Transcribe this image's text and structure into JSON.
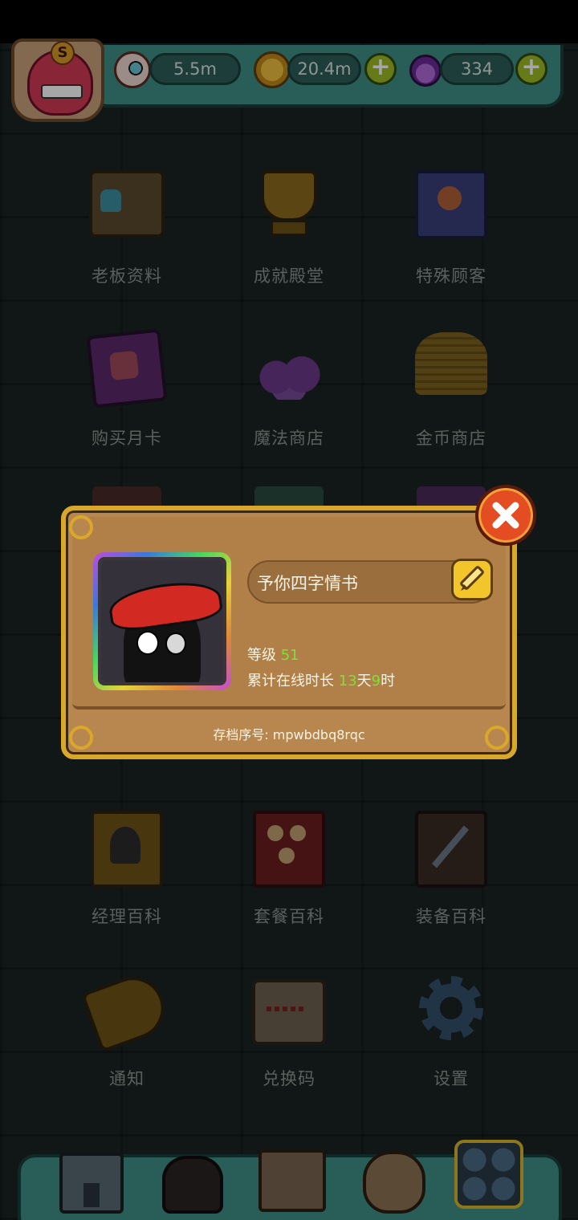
{
  "resources": {
    "eyes": "5.5m",
    "coins": "20.4m",
    "potions": "334"
  },
  "menu": {
    "row1": [
      "老板资料",
      "成就殿堂",
      "特殊顾客"
    ],
    "row2": [
      "购买月卡",
      "魔法商店",
      "金币商店"
    ],
    "row3": [
      "经理百科",
      "套餐百科",
      "装备百科"
    ],
    "row4": [
      "通知",
      "兑换码",
      "设置"
    ]
  },
  "profile": {
    "name": "予你四字情书",
    "level_label": "等级",
    "level_value": "51",
    "online_label": "累计在线时长",
    "online_days": "13",
    "online_days_unit": "天",
    "online_hours": "9",
    "online_hours_unit": "时",
    "save_id": "存档序号: mpwbdbq8rqc"
  },
  "colors": {
    "accent_green": "#7ce23b",
    "panel_teal": "#3f8f86",
    "dialog_wood": "#b8864f",
    "frame_gold": "#d9a82a",
    "close_red": "#e44c22"
  },
  "icons": {
    "eye": "eyeball-icon",
    "coin": "coin-icon",
    "potion": "potion-icon",
    "close": "close-icon",
    "edit": "pencil-icon"
  }
}
